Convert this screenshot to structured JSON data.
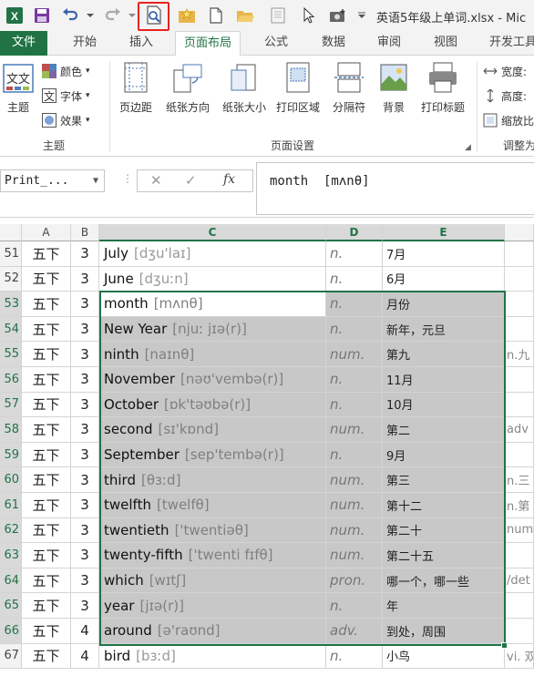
{
  "titlebar": {
    "document_title": "英语5年级上单词.xlsx - Mic"
  },
  "tabs": [
    {
      "label": "文件"
    },
    {
      "label": "开始"
    },
    {
      "label": "插入"
    },
    {
      "label": "页面布局"
    },
    {
      "label": "公式"
    },
    {
      "label": "数据"
    },
    {
      "label": "审阅"
    },
    {
      "label": "视图"
    },
    {
      "label": "开发工具"
    }
  ],
  "ribbon": {
    "theme": {
      "themes_label": "主题",
      "colors_label": "颜色",
      "fonts_label": "字体",
      "effects_label": "效果",
      "group_label": "主题",
      "theme_icon_text": "文文"
    },
    "page_setup": {
      "margins_label": "页边距",
      "orientation_label": "纸张方向",
      "size_label": "纸张大小",
      "print_area_label": "打印区域",
      "breaks_label": "分隔符",
      "background_label": "背景",
      "print_titles_label": "打印标题",
      "group_label": "页面设置"
    },
    "scale": {
      "width_label": "宽度:",
      "height_label": "高度:",
      "scale_label": "缩放比",
      "group_label": "调整为"
    }
  },
  "formula_bar": {
    "name_box": "Print_...",
    "formula": "month  [mʌnθ]"
  },
  "columns": [
    "A",
    "B",
    "C",
    "D",
    "E"
  ],
  "rows": [
    {
      "num": "51",
      "a": "五下",
      "b": "3",
      "word": "July",
      "phonetic": "[dʒu'laɪ]",
      "pos": "n.",
      "meaning": "7月",
      "f": "",
      "shaded": false
    },
    {
      "num": "52",
      "a": "五下",
      "b": "3",
      "word": "June",
      "phonetic": "[dʒuːn]",
      "pos": "n.",
      "meaning": "6月",
      "f": "",
      "shaded": false
    },
    {
      "num": "53",
      "a": "五下",
      "b": "3",
      "word": "month",
      "phonetic": "[mʌnθ]",
      "pos": "n.",
      "meaning": "月份",
      "f": "",
      "shaded": true,
      "active": true
    },
    {
      "num": "54",
      "a": "五下",
      "b": "3",
      "word": "New Year",
      "phonetic": "[njuː jɪə(r)]",
      "pos": "n.",
      "meaning": "新年，元旦",
      "f": "",
      "shaded": true
    },
    {
      "num": "55",
      "a": "五下",
      "b": "3",
      "word": "ninth",
      "phonetic": "[naɪnθ]",
      "pos": "num.",
      "meaning": "第九",
      "f": "n.九",
      "shaded": true
    },
    {
      "num": "56",
      "a": "五下",
      "b": "3",
      "word": "November",
      "phonetic": "[nəʊ'vembə(r)]",
      "pos": "n.",
      "meaning": "11月",
      "f": "",
      "shaded": true
    },
    {
      "num": "57",
      "a": "五下",
      "b": "3",
      "word": "October",
      "phonetic": "[ɒk'təʊbə(r)]",
      "pos": "n.",
      "meaning": "10月",
      "f": "",
      "shaded": true
    },
    {
      "num": "58",
      "a": "五下",
      "b": "3",
      "word": "second",
      "phonetic": "[sɪ'kɒnd]",
      "pos": "num.",
      "meaning": "第二",
      "f": "adv",
      "shaded": true
    },
    {
      "num": "59",
      "a": "五下",
      "b": "3",
      "word": "September",
      "phonetic": "[sep'tembə(r)]",
      "pos": "n.",
      "meaning": "9月",
      "f": "",
      "shaded": true
    },
    {
      "num": "60",
      "a": "五下",
      "b": "3",
      "word": "third",
      "phonetic": "[θɜːd]",
      "pos": "num.",
      "meaning": "第三",
      "f": "n.三",
      "shaded": true
    },
    {
      "num": "61",
      "a": "五下",
      "b": "3",
      "word": "twelfth",
      "phonetic": "[twelfθ]",
      "pos": "num.",
      "meaning": "第十二",
      "f": "n.第",
      "shaded": true
    },
    {
      "num": "62",
      "a": "五下",
      "b": "3",
      "word": "twentieth",
      "phonetic": "['twentiəθ]",
      "pos": "num.",
      "meaning": "第二十",
      "f": "num",
      "shaded": true
    },
    {
      "num": "63",
      "a": "五下",
      "b": "3",
      "word": "twenty-fifth",
      "phonetic": "['twenti fɪfθ]",
      "pos": "num.",
      "meaning": "第二十五",
      "f": "",
      "shaded": true
    },
    {
      "num": "64",
      "a": "五下",
      "b": "3",
      "word": "which",
      "phonetic": "[wɪtʃ]",
      "pos": "pron.",
      "meaning": "哪一个，哪一些",
      "f": "/det",
      "shaded": true
    },
    {
      "num": "65",
      "a": "五下",
      "b": "3",
      "word": "year",
      "phonetic": "[jɪə(r)]",
      "pos": "n.",
      "meaning": "年",
      "f": "",
      "shaded": true
    },
    {
      "num": "66",
      "a": "五下",
      "b": "4",
      "word": "around",
      "phonetic": "[ə'raʊnd]",
      "pos": "adv.",
      "meaning": "到处，周围",
      "f": "",
      "shaded": true
    },
    {
      "num": "67",
      "a": "五下",
      "b": "4",
      "word": "bird",
      "phonetic": "[bɜːd]",
      "pos": "n.",
      "meaning": "小鸟",
      "f": "vi. 双",
      "shaded": false
    }
  ],
  "colors": {
    "accent": "#217346",
    "selection_fill": "#c8c8c8",
    "highlight_box": "#e8231e"
  }
}
